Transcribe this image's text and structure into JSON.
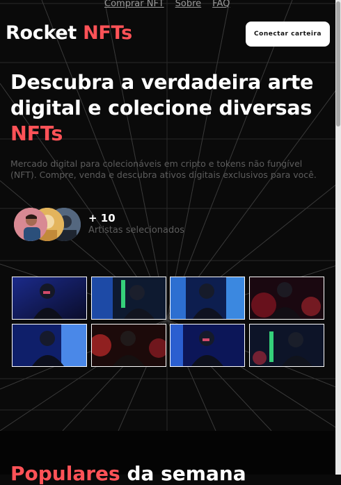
{
  "nav": {
    "links": [
      {
        "label": "Comprar NFT"
      },
      {
        "label": "Sobre"
      },
      {
        "label": "FAQ"
      }
    ]
  },
  "header": {
    "logo_text": "Rocket",
    "logo_accent": "NFTs",
    "connect_button": "Conectar carteira"
  },
  "hero": {
    "title_text": "Descubra a verdadeira arte digital e colecione diversas",
    "title_accent": "NFTs",
    "description": "Mercado digital para colecionáveis em cripto e tokens não fungível (NFT). Compre, venda e descubra ativos digitais exclusivos para você.",
    "artists_count": "+ 10",
    "artists_label": "Artistas selecionados"
  },
  "gallery": {
    "images": [
      {
        "name": "astronaut-blue-1"
      },
      {
        "name": "astronaut-green-1"
      },
      {
        "name": "astronaut-blue-2"
      },
      {
        "name": "astronaut-red-1"
      },
      {
        "name": "astronaut-blue-3"
      },
      {
        "name": "astronaut-red-2"
      },
      {
        "name": "astronaut-blue-4"
      },
      {
        "name": "astronaut-green-2"
      }
    ]
  },
  "popular": {
    "title_accent": "Populares",
    "title_text": "da semana"
  },
  "colors": {
    "accent": "#ff5257",
    "background": "#0a0a0a",
    "muted_text": "#5d5d5d"
  }
}
